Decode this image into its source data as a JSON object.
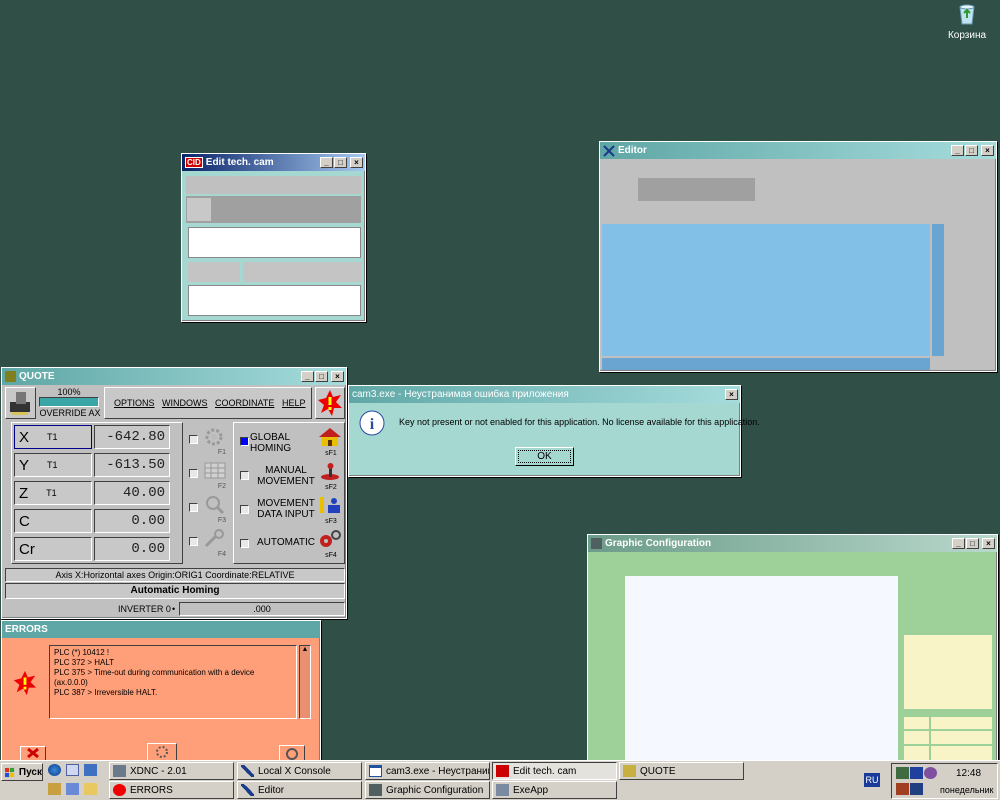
{
  "desktop": {
    "recycle_bin_label": "Корзина"
  },
  "edit_tech_cam": {
    "title": "Edit tech. cam"
  },
  "editor": {
    "title": "Editor"
  },
  "quote": {
    "title": "QUOTE",
    "override_percent": "100%",
    "override_label": "OVERRIDE AX",
    "menu": [
      "OPTIONS",
      "WINDOWS",
      "COORDINATE",
      "HELP"
    ],
    "axes": [
      {
        "name": "X",
        "tool": "T1",
        "value": "-642.80"
      },
      {
        "name": "Y",
        "tool": "T1",
        "value": "-613.50"
      },
      {
        "name": "Z",
        "tool": "T1",
        "value": "40.00"
      },
      {
        "name": "C",
        "tool": "",
        "value": "0.00"
      },
      {
        "name": "Cr",
        "tool": "",
        "value": "0.00"
      }
    ],
    "fkeys": [
      "F1",
      "F2",
      "F3",
      "F4"
    ],
    "modes": [
      "GLOBAL HOMING",
      "MANUAL MOVEMENT",
      "MOVEMENT DATA INPUT",
      "AUTOMATIC"
    ],
    "sfkeys": [
      "sF1",
      "sF2",
      "sF3",
      "sF4"
    ],
    "status_line": "Axis X:Horizontal axes  Origin:ORIG1  Coordinate:RELATIVE",
    "state": "Automatic Homing",
    "inverter_label": "INVERTER 0",
    "inverter_value": ".000",
    "colors": {
      "mode_selected": "#0000ff"
    }
  },
  "error_dialog": {
    "title": "cam3.exe - Неустранимая ошибка приложения",
    "message": "Key not present or not enabled for this application. No license available for this application.",
    "ok_label": "OK"
  },
  "graphic_config": {
    "title": "Graphic Configuration"
  },
  "errors": {
    "title": "ERRORS",
    "lines": [
      "PLC (*) 10412 !",
      "PLC 372 > HALT",
      "PLC 375 > Time-out during communication with a device",
      "(ax.0.0.0)",
      "PLC 387 > Irreversible HALT."
    ]
  },
  "taskbar": {
    "start_label": "Пуск",
    "tasks_row1": [
      "XDNC - 2.01",
      "Local X Console",
      "cam3.exe - Неустранима...",
      "Edit tech. cam",
      "QUOTE"
    ],
    "tasks_row2": [
      "ERRORS",
      "Editor",
      "Graphic Configuration",
      "ExeApp"
    ],
    "lang": "RU",
    "time": "12:48",
    "day": "понедельник"
  }
}
